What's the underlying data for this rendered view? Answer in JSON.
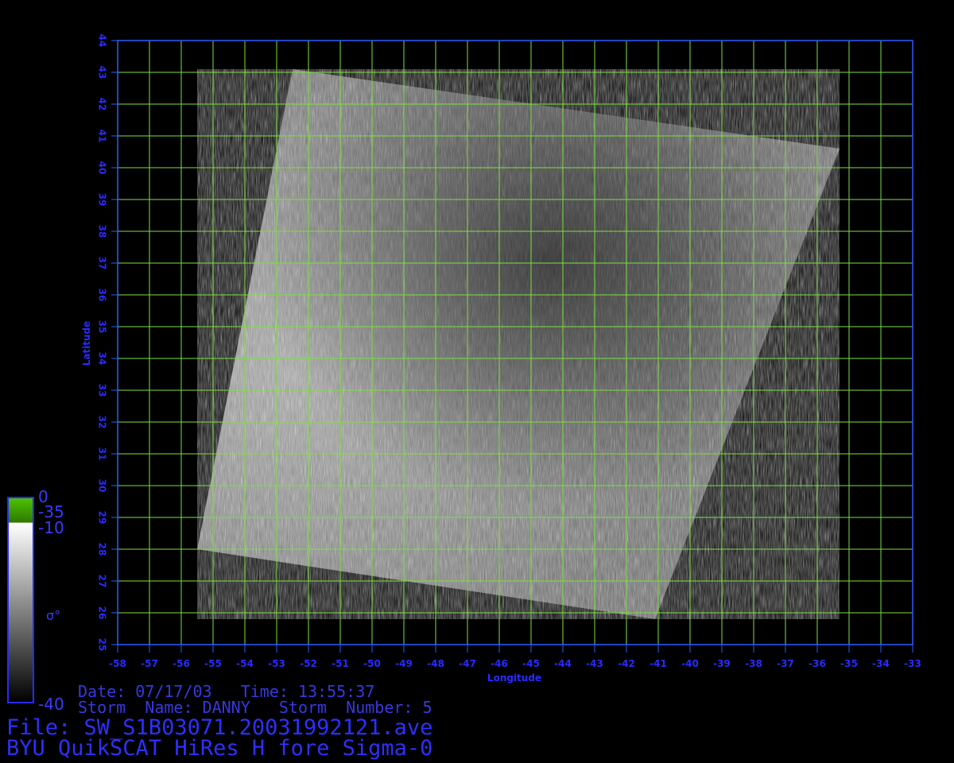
{
  "map": {
    "x_label": "Longitude",
    "y_label": "Latitude",
    "lon_range": [
      -58,
      -33
    ],
    "lat_range": [
      25,
      44
    ],
    "lon_ticks": [
      -58,
      -57,
      -56,
      -55,
      -54,
      -53,
      -52,
      -51,
      -50,
      -49,
      -48,
      -47,
      -46,
      -45,
      -44,
      -43,
      -42,
      -41,
      -40,
      -39,
      -38,
      -37,
      -36,
      -35,
      -34,
      -33
    ],
    "lat_ticks": [
      25,
      26,
      27,
      28,
      29,
      30,
      31,
      32,
      33,
      34,
      35,
      36,
      37,
      38,
      39,
      40,
      41,
      42,
      43,
      44
    ],
    "swath_corners": [
      [
        -52.5,
        43.1
      ],
      [
        -35.3,
        40.6
      ],
      [
        -41.1,
        25.8
      ],
      [
        -55.5,
        28.0
      ]
    ],
    "colors": {
      "frame": "#2a5cff",
      "grid": "#7be040",
      "tick_text": "#2a2aff",
      "background": "#000000"
    }
  },
  "colorbar": {
    "labels": {
      "top": "0",
      "green_end": "-35",
      "white_start": "-10",
      "bottom": "-40"
    },
    "symbol": "σ°",
    "colors": {
      "green": "#4fc200",
      "white": "#ffffff",
      "black": "#000000",
      "border": "#2a2aff"
    }
  },
  "info": {
    "date_line": "Date: 07/17/03   Time: 13:55:37",
    "storm_line": "Storm  Name: DANNY   Storm  Number: 5",
    "file_line": "File: SW_S1B03071.20031992121.ave",
    "title_line": "BYU QuikSCAT HiRes H fore Sigma-0"
  }
}
